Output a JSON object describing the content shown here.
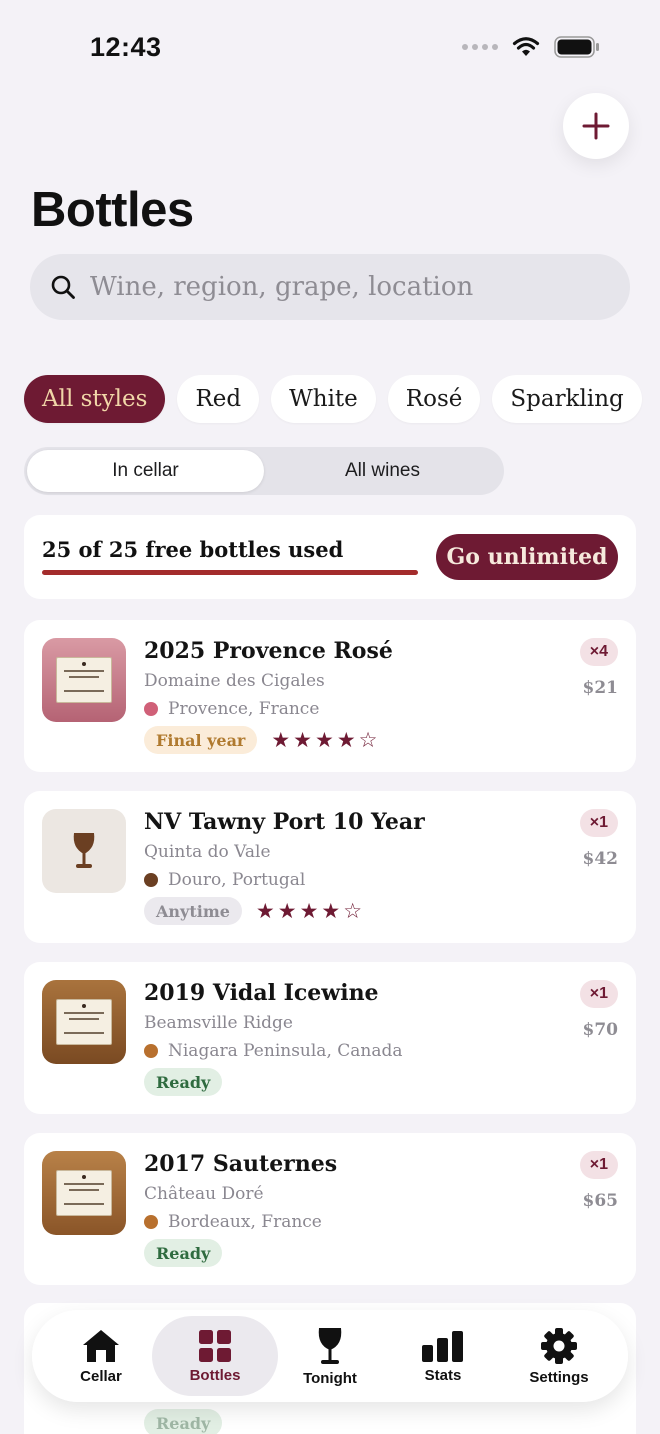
{
  "status_bar": {
    "time": "12:43"
  },
  "header": {
    "title": "Bottles",
    "add_icon": "plus-icon"
  },
  "search": {
    "placeholder": "Wine, region, grape, location"
  },
  "style_filters": [
    "All styles",
    "Red",
    "White",
    "Rosé",
    "Sparkling"
  ],
  "selected_style": "All styles",
  "cellar_toggle": {
    "options": [
      "In cellar",
      "All wines"
    ],
    "selected": "In cellar"
  },
  "limit": {
    "text": "25 of 25 free bottles used",
    "used": 25,
    "total": 25,
    "button": "Go unlimited"
  },
  "bottles": [
    {
      "name": "2025 Provence Rosé",
      "producer": "Domaine des Cigales",
      "region": "Provence, France",
      "region_color": "#d06078",
      "badge": "Final year",
      "stars": "★★★★☆",
      "rating": 4,
      "qty": "×4",
      "price": "$21"
    },
    {
      "name": "NV Tawny Port 10 Year",
      "producer": "Quinta do Vale",
      "region": "Douro, Portugal",
      "region_color": "#6b3f22",
      "badge": "Anytime",
      "stars": "★★★★☆",
      "rating": 4,
      "qty": "×1",
      "price": "$42"
    },
    {
      "name": "2019 Vidal Icewine",
      "producer": "Beamsville Ridge",
      "region": "Niagara Peninsula, Canada",
      "region_color": "#b8702e",
      "badge": "Ready",
      "stars": "",
      "rating": null,
      "qty": "×1",
      "price": "$70"
    },
    {
      "name": "2017 Sauternes",
      "producer": "Château Doré",
      "region": "Bordeaux, France",
      "region_color": "#b8702e",
      "badge": "Ready",
      "stars": "",
      "rating": null,
      "qty": "×1",
      "price": "$65"
    }
  ],
  "peek_bottle": {
    "badge": "Ready"
  },
  "tabbar": [
    {
      "label": "Cellar",
      "icon": "house-icon"
    },
    {
      "label": "Bottles",
      "icon": "grid-icon"
    },
    {
      "label": "Tonight",
      "icon": "wine-glass-icon"
    },
    {
      "label": "Stats",
      "icon": "bar-chart-icon"
    },
    {
      "label": "Settings",
      "icon": "gear-icon"
    }
  ],
  "active_tab": "Bottles",
  "colors": {
    "accent": "#6e1a33",
    "background": "#f4f2f7",
    "progress": "#a32c2c"
  }
}
